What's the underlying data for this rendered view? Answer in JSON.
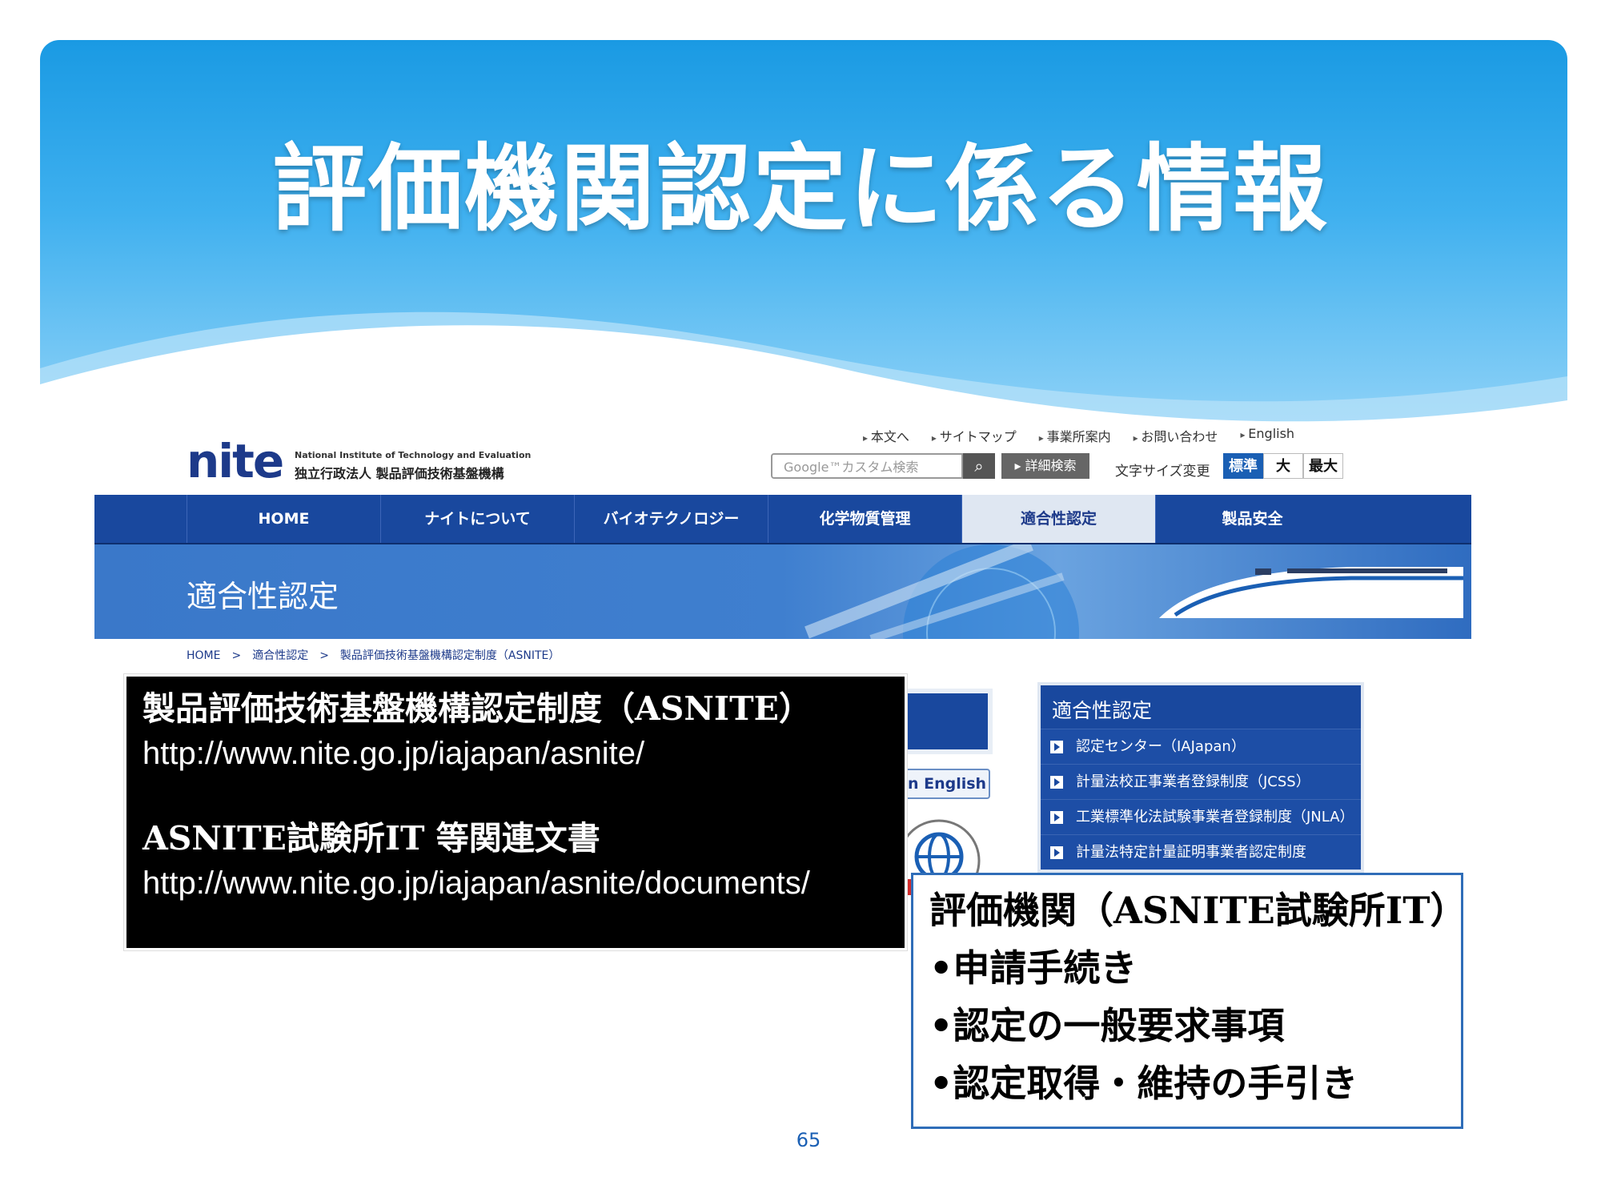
{
  "slide": {
    "title": "評価機関認定に係る情報",
    "page_number": "65"
  },
  "website": {
    "logo": {
      "name": "nite",
      "english": "National Institute of Technology and Evaluation",
      "japanese": "独立行政法人 製品評価技術基盤機構"
    },
    "utility_links": [
      "本文へ",
      "サイトマップ",
      "事業所案内",
      "お問い合わせ",
      "English"
    ],
    "search": {
      "placeholder": "Google™カスタム検索",
      "detail_label": "▸ 詳細検索"
    },
    "font_size": {
      "label": "文字サイズ変更",
      "standard": "標準",
      "large": "大",
      "xlarge": "最大"
    },
    "nav": [
      "HOME",
      "ナイトについて",
      "バイオテクノロジー",
      "化学物質管理",
      "適合性認定",
      "製品安全"
    ],
    "nav_active_index": 4,
    "banner_title": "適合性認定",
    "breadcrumb": "HOME　>　適合性認定　>　製品評価技術基盤機構認定制度（ASNITE）",
    "english_link": "e in English",
    "side_menu": {
      "title": "適合性認定",
      "items": [
        "認定センター（IAJapan）",
        "計量法校正事業者登録制度（JCSS）",
        "工業標準化法試験事業者登録制度（JNLA）",
        "計量法特定計量証明事業者認定制度"
      ]
    },
    "colors": {
      "nav_blue": "#19489e",
      "banner_blue": "#3a78c9"
    }
  },
  "asnite_box": {
    "title1": "製品評価技術基盤機構認定制度（ASNITE）",
    "url1": "http://www.nite.go.jp/iajapan/asnite/",
    "title2": "ASNITE試験所IT 等関連文書",
    "url2": "http://www.nite.go.jp/iajapan/asnite/documents/"
  },
  "lab_box": {
    "heading": "評価機関（ASNITE試験所IT）",
    "items": [
      "•申請手続き",
      "•認定の一般要求事項",
      "•認定取得・維持の手引き"
    ]
  }
}
